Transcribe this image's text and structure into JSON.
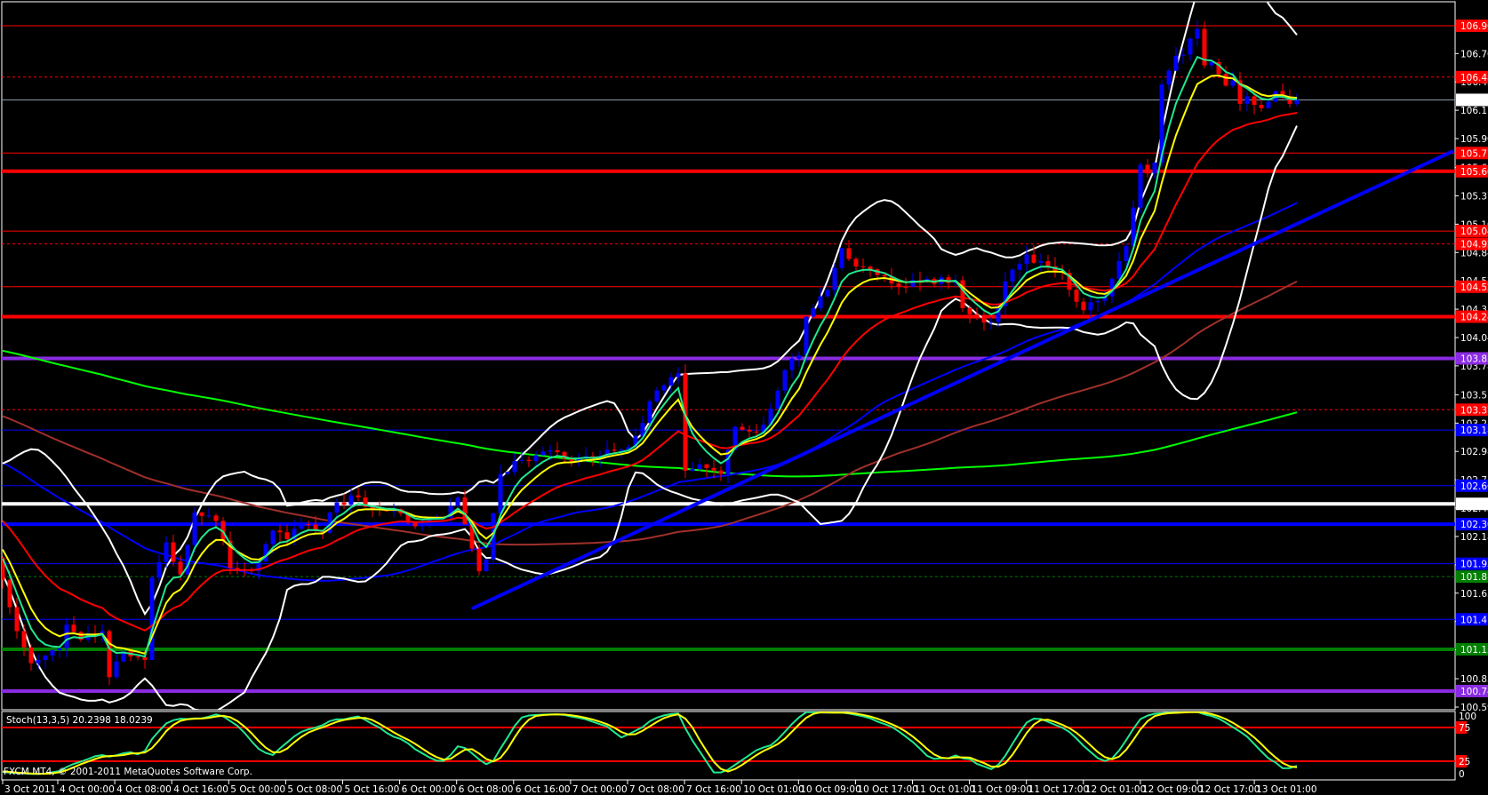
{
  "indicator_label": "Stoch(13,3,5) 20.2398 18.0239",
  "copyright": "FXCM MT4, © 2001-2011 MetaQuotes Software Corp.",
  "current_price": "106.267",
  "colors": {
    "background": "#000000",
    "bull": "#0000ff",
    "bear": "#ff0000",
    "frame": "#ffffff",
    "ema_fast": "#20e890",
    "ema_mid": "#ffff00",
    "ema_slow": "#ff0000",
    "ma55": "#0000ff",
    "ma100": "#a0302a",
    "ma200": "#00ff00",
    "bollinger": "#ffffff",
    "stoch_main": "#20e890",
    "stoch_signal": "#ffff00",
    "stoch_levels": "#ff0000"
  },
  "price_axis_ticks": [
    "106.700",
    "106.435",
    "106.170",
    "105.905",
    "105.635",
    "105.370",
    "105.105",
    "104.840",
    "104.575",
    "104.310",
    "104.045",
    "103.780",
    "103.510",
    "103.245",
    "102.980",
    "102.715",
    "102.450",
    "102.185",
    "101.920",
    "101.655",
    "101.390",
    "101.125",
    "100.855",
    "100.590"
  ],
  "stoch_axis_ticks": [
    "100",
    "75",
    "25",
    "0"
  ],
  "time_axis_labels": [
    "3 Oct 2011",
    "4 Oct 00:00",
    "4 Oct 08:00",
    "4 Oct 16:00",
    "5 Oct 00:00",
    "5 Oct 08:00",
    "5 Oct 16:00",
    "6 Oct 00:00",
    "6 Oct 08:00",
    "6 Oct 16:00",
    "7 Oct 00:00",
    "7 Oct 08:00",
    "7 Oct 16:00",
    "10 Oct 01:00",
    "10 Oct 09:00",
    "10 Oct 17:00",
    "11 Oct 01:00",
    "11 Oct 09:00",
    "11 Oct 17:00",
    "12 Oct 01:00",
    "12 Oct 09:00",
    "12 Oct 17:00",
    "13 Oct 01:00"
  ],
  "levels": [
    {
      "price": 106.96,
      "label": "106.960",
      "color": "#ff0000",
      "style": "thin"
    },
    {
      "price": 106.48,
      "label": "106.480",
      "color": "#ff0000",
      "style": "dashed"
    },
    {
      "price": 105.77,
      "label": "105.770",
      "color": "#ff0000",
      "style": "thin"
    },
    {
      "price": 105.6,
      "label": "105.600",
      "color": "#ff0000",
      "style": "thick"
    },
    {
      "price": 105.04,
      "label": "105.040",
      "color": "#ff0000",
      "style": "thin"
    },
    {
      "price": 104.92,
      "label": "104.920",
      "color": "#ff0000",
      "style": "dashed"
    },
    {
      "price": 104.52,
      "label": "104.520",
      "color": "#ff0000",
      "style": "thin"
    },
    {
      "price": 104.24,
      "label": "104.240",
      "color": "#ff0000",
      "style": "thick"
    },
    {
      "price": 103.85,
      "label": "103.850",
      "color": "#8a2be2",
      "style": "thick"
    },
    {
      "price": 103.37,
      "label": "103.370",
      "color": "#ff0000",
      "style": "dashed"
    },
    {
      "price": 103.18,
      "label": "103.180",
      "color": "#0000ff",
      "style": "thin"
    },
    {
      "price": 102.66,
      "label": "102.660",
      "color": "#0000ff",
      "style": "thin"
    },
    {
      "price": 102.49,
      "label": "102.490",
      "color": "#ffffff",
      "style": "thick"
    },
    {
      "price": 102.3,
      "label": "102.300",
      "color": "#0000ff",
      "style": "thick"
    },
    {
      "price": 101.93,
      "label": "101.930",
      "color": "#0000ff",
      "style": "thin"
    },
    {
      "price": 101.81,
      "label": "101.810",
      "color": "#008000",
      "style": "dashed"
    },
    {
      "price": 101.41,
      "label": "101.410",
      "color": "#0000ff",
      "style": "thin"
    },
    {
      "price": 101.13,
      "label": "101.130",
      "color": "#008000",
      "style": "thick"
    },
    {
      "price": 100.74,
      "label": "100.740",
      "color": "#8a2be2",
      "style": "thick"
    }
  ],
  "chart_data": {
    "type": "candlestick",
    "symbol_timeframe": "H1",
    "ylim": [
      100.59,
      106.96
    ],
    "x_unit": "hourly bar index from 3 Oct 2011",
    "bars": 183,
    "close_anchors": [
      [
        0,
        101.78
      ],
      [
        2,
        101.3
      ],
      [
        4,
        101.0
      ],
      [
        5,
        101.03
      ],
      [
        8,
        101.14
      ],
      [
        9,
        101.36
      ],
      [
        11,
        101.22
      ],
      [
        14,
        101.3
      ],
      [
        15,
        100.87
      ],
      [
        17,
        101.11
      ],
      [
        20,
        101.03
      ],
      [
        21,
        101.8
      ],
      [
        23,
        102.13
      ],
      [
        25,
        101.83
      ],
      [
        27,
        102.41
      ],
      [
        30,
        102.33
      ],
      [
        32,
        101.89
      ],
      [
        35,
        101.86
      ],
      [
        38,
        102.24
      ],
      [
        40,
        102.16
      ],
      [
        42,
        102.3
      ],
      [
        45,
        102.22
      ],
      [
        46,
        102.41
      ],
      [
        49,
        102.57
      ],
      [
        52,
        102.44
      ],
      [
        55,
        102.44
      ],
      [
        58,
        102.28
      ],
      [
        62,
        102.36
      ],
      [
        64,
        102.55
      ],
      [
        67,
        101.86
      ],
      [
        68,
        101.97
      ],
      [
        70,
        102.77
      ],
      [
        73,
        102.9
      ],
      [
        77,
        102.99
      ],
      [
        80,
        102.88
      ],
      [
        84,
        102.94
      ],
      [
        88,
        103.02
      ],
      [
        92,
        103.55
      ],
      [
        95,
        103.71
      ],
      [
        96,
        102.8
      ],
      [
        98,
        102.86
      ],
      [
        101,
        102.77
      ],
      [
        103,
        103.21
      ],
      [
        106,
        103.16
      ],
      [
        108,
        103.38
      ],
      [
        110,
        103.74
      ],
      [
        112,
        103.88
      ],
      [
        113,
        104.24
      ],
      [
        116,
        104.49
      ],
      [
        118,
        104.88
      ],
      [
        120,
        104.71
      ],
      [
        123,
        104.63
      ],
      [
        126,
        104.52
      ],
      [
        129,
        104.57
      ],
      [
        134,
        104.58
      ],
      [
        135,
        104.32
      ],
      [
        137,
        104.24
      ],
      [
        139,
        104.19
      ],
      [
        141,
        104.57
      ],
      [
        144,
        104.82
      ],
      [
        147,
        104.71
      ],
      [
        149,
        104.65
      ],
      [
        151,
        104.38
      ],
      [
        152,
        104.3
      ],
      [
        155,
        104.43
      ],
      [
        157,
        104.76
      ],
      [
        158,
        104.9
      ],
      [
        159,
        105.26
      ],
      [
        160,
        105.66
      ],
      [
        161,
        105.58
      ],
      [
        162,
        105.68
      ],
      [
        163,
        106.41
      ],
      [
        164,
        106.54
      ],
      [
        165,
        106.68
      ],
      [
        166,
        106.69
      ],
      [
        167,
        106.84
      ],
      [
        168,
        106.93
      ],
      [
        169,
        106.59
      ],
      [
        170,
        106.62
      ],
      [
        171,
        106.51
      ],
      [
        172,
        106.4
      ],
      [
        173,
        106.45
      ],
      [
        174,
        106.23
      ],
      [
        175,
        106.3
      ],
      [
        176,
        106.22
      ],
      [
        177,
        106.19
      ],
      [
        178,
        106.25
      ],
      [
        179,
        106.35
      ],
      [
        180,
        106.3
      ],
      [
        181,
        106.23
      ],
      [
        182,
        106.267
      ]
    ],
    "prehistory_anchors": [
      [
        -220,
        104.2
      ],
      [
        -150,
        104.8
      ],
      [
        -80,
        103.9
      ],
      [
        -40,
        103.3
      ],
      [
        -15,
        102.6
      ],
      [
        -1,
        102.0
      ]
    ],
    "moving_averages": [
      {
        "name": "EMA 5",
        "period": 5,
        "type": "ema",
        "color_key": "ema_fast"
      },
      {
        "name": "EMA 8",
        "period": 8,
        "type": "ema",
        "color_key": "ema_mid"
      },
      {
        "name": "EMA 21",
        "period": 21,
        "type": "ema",
        "color_key": "ema_slow"
      },
      {
        "name": "SMA 55",
        "period": 55,
        "type": "sma",
        "color_key": "ma55"
      },
      {
        "name": "SMA 100",
        "period": 100,
        "type": "sma",
        "color_key": "ma100"
      },
      {
        "name": "SMA 200",
        "period": 200,
        "type": "sma",
        "color_key": "ma200"
      }
    ],
    "bollinger": {
      "period": 20,
      "deviation": 2
    },
    "stochastic": {
      "k": 13,
      "d": 3,
      "slowing": 5,
      "levels": [
        75,
        25
      ],
      "last_main": 20.2398,
      "last_signal": 18.0239
    },
    "trendline": {
      "from": [
        66,
        101.51
      ],
      "to": [
        204,
        105.79
      ],
      "color": "#0000ff"
    }
  }
}
